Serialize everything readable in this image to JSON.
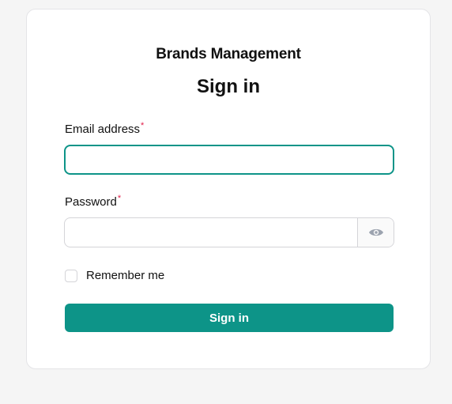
{
  "header": {
    "app_title": "Brands Management",
    "page_title": "Sign in"
  },
  "form": {
    "email_label": "Email address",
    "email_value": "",
    "password_label": "Password",
    "password_value": "",
    "required_mark": "*",
    "remember_label": "Remember me",
    "remember_checked": false,
    "submit_label": "Sign in"
  },
  "icons": {
    "password_toggle": "eye-icon"
  },
  "colors": {
    "accent": "#0d9488",
    "required": "#e11d48",
    "page_background": "#f5f5f5"
  }
}
